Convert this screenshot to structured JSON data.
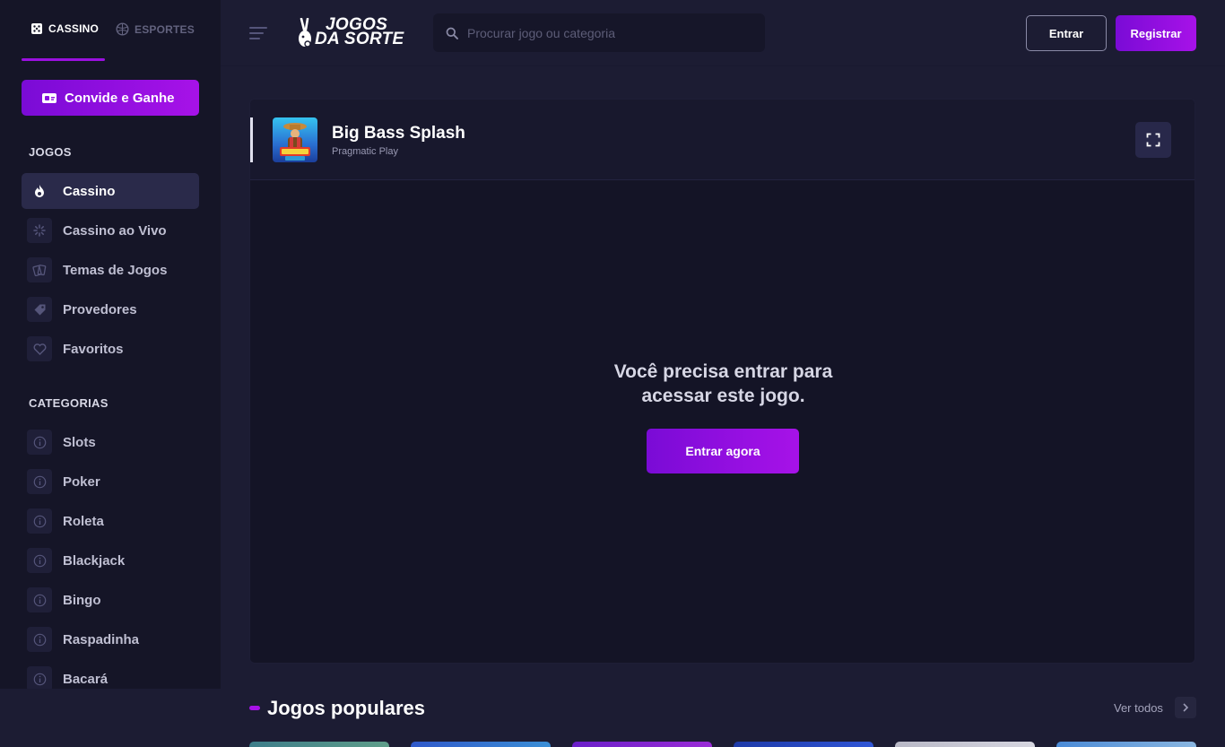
{
  "sidebar": {
    "tabs": [
      {
        "label": "CASSINO",
        "icon": "dice-icon",
        "active": true
      },
      {
        "label": "ESPORTES",
        "icon": "ball-icon",
        "active": false
      }
    ],
    "invite_button": "Convide e Ganhe",
    "games_title": "JOGOS",
    "games": [
      {
        "label": "Cassino",
        "icon": "fire-icon",
        "active": true
      },
      {
        "label": "Cassino ao Vivo",
        "icon": "live-icon"
      },
      {
        "label": "Temas de Jogos",
        "icon": "cards-icon"
      },
      {
        "label": "Provedores",
        "icon": "tag-icon"
      },
      {
        "label": "Favoritos",
        "icon": "heart-icon"
      }
    ],
    "categories_title": "CATEGORIAS",
    "categories": [
      {
        "label": "Slots",
        "icon": "info-icon"
      },
      {
        "label": "Poker",
        "icon": "info-icon"
      },
      {
        "label": "Roleta",
        "icon": "info-icon"
      },
      {
        "label": "Blackjack",
        "icon": "info-icon"
      },
      {
        "label": "Bingo",
        "icon": "info-icon"
      },
      {
        "label": "Raspadinha",
        "icon": "info-icon"
      },
      {
        "label": "Bacará",
        "icon": "info-icon"
      }
    ]
  },
  "header": {
    "logo_line1": "JOGOS",
    "logo_line2": "DA SORTE",
    "search_placeholder": "Procurar jogo ou categoria",
    "login_label": "Entrar",
    "register_label": "Registrar"
  },
  "game": {
    "title": "Big Bass Splash",
    "provider": "Pragmatic Play",
    "login_message": "Você precisa entrar para acessar este jogo.",
    "login_button": "Entrar agora"
  },
  "popular": {
    "title": "Jogos populares",
    "see_all": "Ver todos"
  },
  "colors": {
    "accent": "#a712e8",
    "background": "#1c1c33",
    "sidebar": "#151527"
  }
}
